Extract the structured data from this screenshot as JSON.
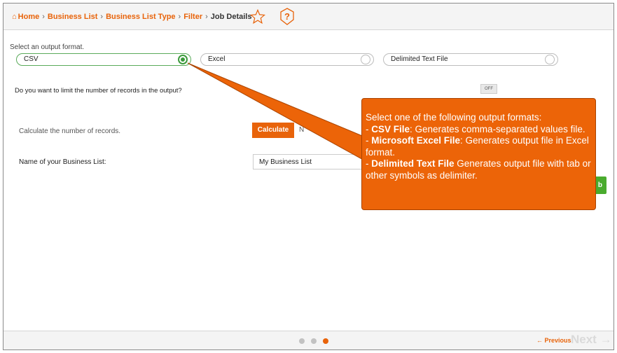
{
  "breadcrumb": {
    "items": [
      "Home",
      "Business List",
      "Business List Type",
      "Filter"
    ],
    "current": "Job Details"
  },
  "format": {
    "label": "Select an output format.",
    "options": [
      "CSV",
      "Excel",
      "Delimited Text File"
    ],
    "selected": "CSV"
  },
  "limit": {
    "question": "Do you want to limit the number of records in the output?",
    "toggle": "OFF"
  },
  "calculate": {
    "label": "Calculate the number of records.",
    "button": "Calculate",
    "partial_text": "N"
  },
  "business_list": {
    "label": "Name of your Business List:",
    "value": "My Business List"
  },
  "green_button_partial": "b",
  "tooltip": {
    "intro": "Select one of the following output formats:",
    "csv_title": "CSV File",
    "csv_desc": ": Generates comma-separated values file.",
    "excel_title": "Microsoft Excel File",
    "excel_desc": ": Generates output file in Excel format.",
    "delim_title": "Delimited Text File",
    "delim_desc": " Generates output file with tab or other symbols as delimiter."
  },
  "pager": {
    "total": 3,
    "active": 3
  },
  "nav": {
    "previous": "← Previous",
    "next": "Next →"
  },
  "colors": {
    "accent": "#e8630a",
    "selected_radio": "#3b9a3b",
    "green_button": "#4aab2e"
  }
}
